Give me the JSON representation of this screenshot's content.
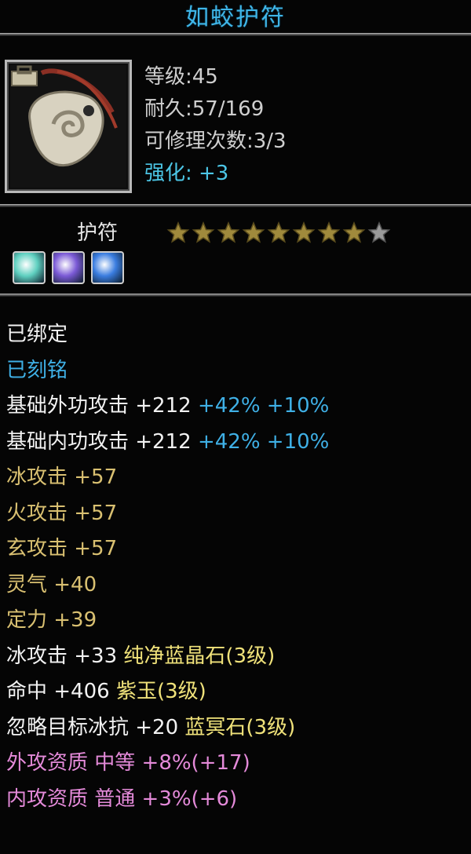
{
  "item": {
    "name": "如蛟护符",
    "level_label": "等级:45",
    "durability_label": "耐久:57/169",
    "repair_label": "可修理次数:3/3",
    "enhance_label": "强化: +3",
    "type": "护符",
    "stars_filled": 8,
    "stars_total": 9,
    "gems": [
      {
        "name": "gem-icon-teal",
        "color": "#5fd0c0"
      },
      {
        "name": "gem-icon-purple",
        "color": "#7b5ad6"
      },
      {
        "name": "gem-icon-blue",
        "color": "#3a7de0"
      }
    ]
  },
  "attributes": [
    {
      "parts": [
        {
          "text": "已绑定",
          "color": "white"
        }
      ]
    },
    {
      "parts": [
        {
          "text": "已刻铭",
          "color": "blue"
        }
      ]
    },
    {
      "parts": [
        {
          "text": "基础外功攻击 +212",
          "color": "white"
        },
        {
          "text": " +42% +10%",
          "color": "blue"
        }
      ]
    },
    {
      "parts": [
        {
          "text": "基础内功攻击 +212",
          "color": "white"
        },
        {
          "text": " +42% +10%",
          "color": "blue"
        }
      ]
    },
    {
      "parts": [
        {
          "text": "冰攻击 +57",
          "color": "gold"
        }
      ]
    },
    {
      "parts": [
        {
          "text": "火攻击 +57",
          "color": "gold"
        }
      ]
    },
    {
      "parts": [
        {
          "text": "玄攻击 +57",
          "color": "gold"
        }
      ]
    },
    {
      "parts": [
        {
          "text": "灵气 +40",
          "color": "gold"
        }
      ]
    },
    {
      "parts": [
        {
          "text": "定力 +39",
          "color": "gold"
        }
      ]
    },
    {
      "parts": [
        {
          "text": "冰攻击 +33",
          "color": "white"
        },
        {
          "text": " 纯净蓝晶石(3级)",
          "color": "yellow"
        }
      ]
    },
    {
      "parts": [
        {
          "text": "命中 +406",
          "color": "white"
        },
        {
          "text": " 紫玉(3级)",
          "color": "yellow"
        }
      ]
    },
    {
      "parts": [
        {
          "text": "忽略目标冰抗 +20",
          "color": "white"
        },
        {
          "text": " 蓝冥石(3级)",
          "color": "yellow"
        }
      ]
    },
    {
      "parts": [
        {
          "text": "外攻资质  中等 +8%(+17)",
          "color": "pink"
        }
      ]
    },
    {
      "parts": [
        {
          "text": "内攻资质  普通 +3%(+6)",
          "color": "pink"
        }
      ]
    }
  ],
  "colors": {
    "white": "#f2f2f2",
    "blue": "#3fb0e6",
    "gold": "#d9c071",
    "yellow": "#f0e27a",
    "pink": "#e48ad9",
    "title": "#3fb6e8"
  }
}
